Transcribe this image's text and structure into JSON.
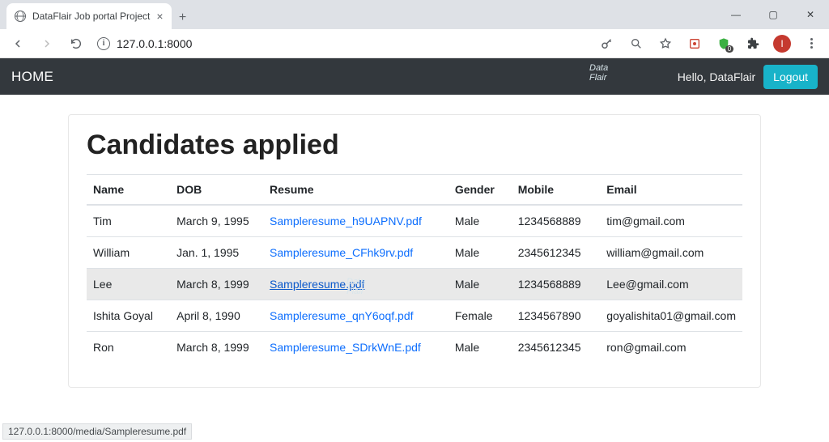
{
  "browser": {
    "tab_title": "DataFlair Job portal Project",
    "url": "127.0.0.1:8000",
    "avatar_initial": "I",
    "status_bar": "127.0.0.1:8000/media/Sampleresume.pdf"
  },
  "navbar": {
    "home": "HOME",
    "greeting": "Hello, DataFlair",
    "logout": "Logout"
  },
  "page": {
    "title": "Candidates applied"
  },
  "table": {
    "headers": {
      "name": "Name",
      "dob": "DOB",
      "resume": "Resume",
      "gender": "Gender",
      "mobile": "Mobile",
      "email": "Email"
    },
    "rows": [
      {
        "name": "Tim",
        "dob": "March 9, 1995",
        "resume": "Sampleresume_h9UAPNV.pdf",
        "gender": "Male",
        "mobile": "1234568889",
        "email": "tim@gmail.com",
        "hover": false
      },
      {
        "name": "William",
        "dob": "Jan. 1, 1995",
        "resume": "Sampleresume_CFhk9rv.pdf",
        "gender": "Male",
        "mobile": "2345612345",
        "email": "william@gmail.com",
        "hover": false
      },
      {
        "name": "Lee",
        "dob": "March 8, 1999",
        "resume": "Sampleresume.pdf",
        "gender": "Male",
        "mobile": "1234568889",
        "email": "Lee@gmail.com",
        "hover": true
      },
      {
        "name": "Ishita Goyal",
        "dob": "April 8, 1990",
        "resume": "Sampleresume_qnY6oqf.pdf",
        "gender": "Female",
        "mobile": "1234567890",
        "email": "goyalishita01@gmail.com",
        "hover": false
      },
      {
        "name": "Ron",
        "dob": "March 8, 1999",
        "resume": "Sampleresume_SDrkWnE.pdf",
        "gender": "Male",
        "mobile": "2345612345",
        "email": "ron@gmail.com",
        "hover": false
      }
    ]
  }
}
